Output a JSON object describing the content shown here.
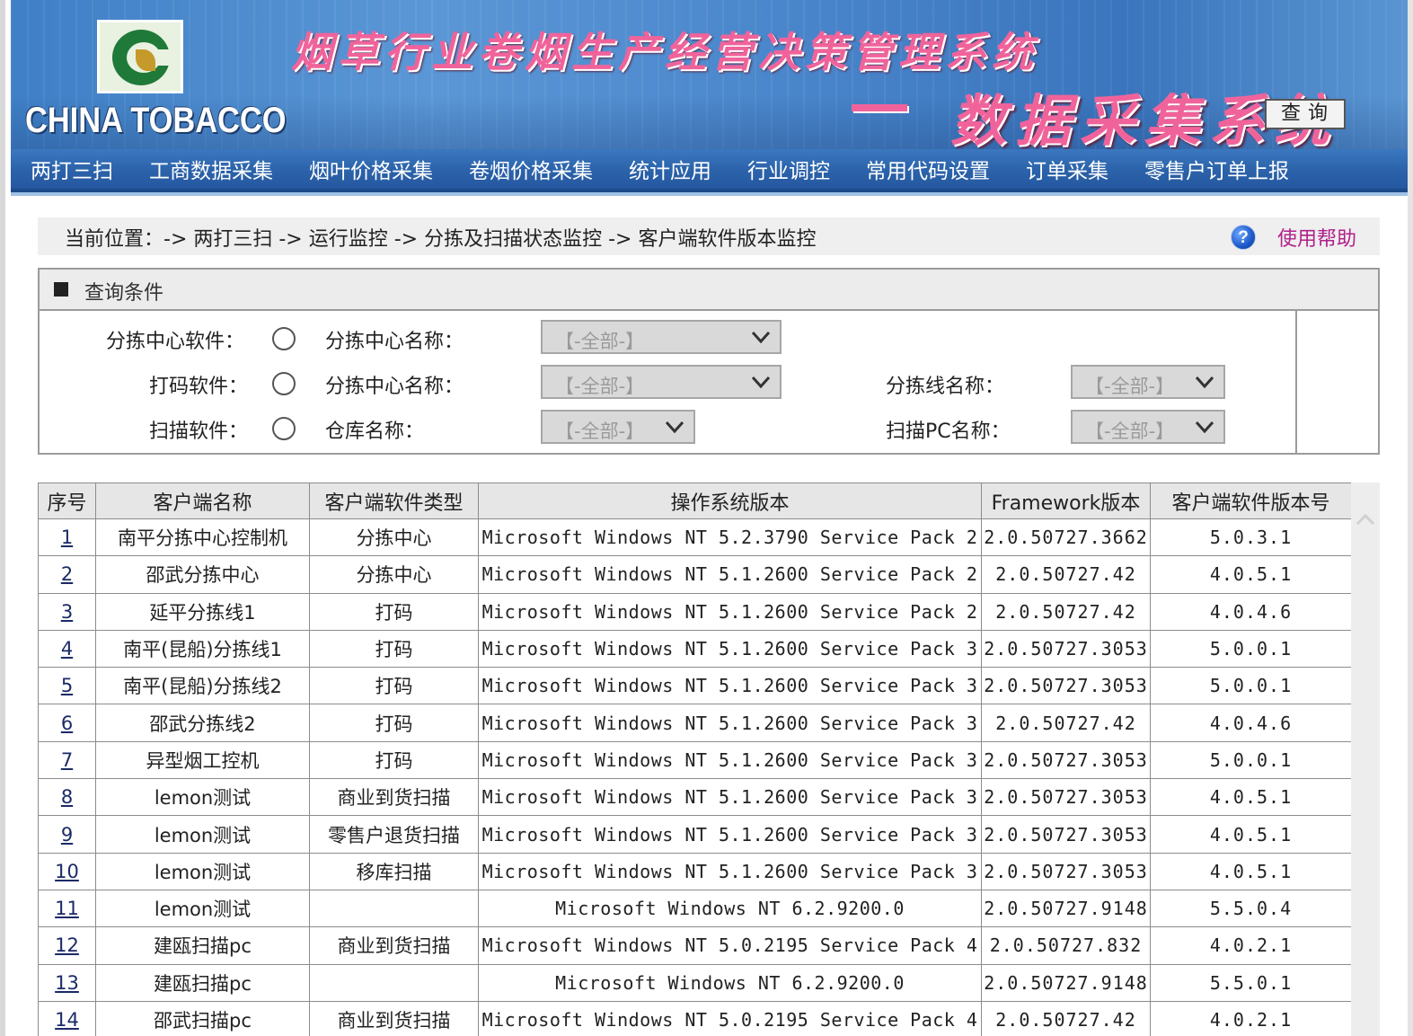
{
  "banner": {
    "brand": "CHINA TOBACCO",
    "title_main": "烟草行业卷烟生产经营决策管理系统",
    "title_sub": "数据采集系统"
  },
  "nav": {
    "items": [
      "两打三扫",
      "工商数据采集",
      "烟叶价格采集",
      "卷烟价格采集",
      "统计应用",
      "行业调控",
      "常用代码设置",
      "订单采集",
      "零售户订单上报"
    ]
  },
  "breadcrumb": {
    "path": "当前位置：-> 两打三扫 -> 运行监控 -> 分拣及扫描状态监控 -> 客户端软件版本监控",
    "help_label": "使用帮助"
  },
  "query": {
    "title": "查询条件",
    "rows": [
      {
        "radio_label": "分拣中心软件：",
        "field1_label": "分拣中心名称：",
        "field1_value": "【-全部-】",
        "field2_label": "",
        "field2_value": ""
      },
      {
        "radio_label": "打码软件：",
        "field1_label": "分拣中心名称：",
        "field1_value": "【-全部-】",
        "field2_label": "分拣线名称：",
        "field2_value": "【-全部-】"
      },
      {
        "radio_label": "扫描软件：",
        "field1_label": "仓库名称：",
        "field1_value": "【-全部-】",
        "field2_label": "扫描PC名称：",
        "field2_value": "【-全部-】"
      }
    ],
    "button_label": "查询"
  },
  "table": {
    "headers": [
      "序号",
      "客户端名称",
      "客户端软件类型",
      "操作系统版本",
      "Framework版本",
      "客户端软件版本号"
    ],
    "rows": [
      [
        "1",
        "南平分拣中心控制机",
        "分拣中心",
        "Microsoft Windows NT 5.2.3790 Service Pack 2",
        "2.0.50727.3662",
        "5.0.3.1"
      ],
      [
        "2",
        "邵武分拣中心",
        "分拣中心",
        "Microsoft Windows NT 5.1.2600 Service Pack 2",
        "2.0.50727.42",
        "4.0.5.1"
      ],
      [
        "3",
        "延平分拣线1",
        "打码",
        "Microsoft Windows NT 5.1.2600 Service Pack 2",
        "2.0.50727.42",
        "4.0.4.6"
      ],
      [
        "4",
        "南平(昆船)分拣线1",
        "打码",
        "Microsoft Windows NT 5.1.2600 Service Pack 3",
        "2.0.50727.3053",
        "5.0.0.1"
      ],
      [
        "5",
        "南平(昆船)分拣线2",
        "打码",
        "Microsoft Windows NT 5.1.2600 Service Pack 3",
        "2.0.50727.3053",
        "5.0.0.1"
      ],
      [
        "6",
        "邵武分拣线2",
        "打码",
        "Microsoft Windows NT 5.1.2600 Service Pack 3",
        "2.0.50727.42",
        "4.0.4.6"
      ],
      [
        "7",
        "异型烟工控机",
        "打码",
        "Microsoft Windows NT 5.1.2600 Service Pack 3",
        "2.0.50727.3053",
        "5.0.0.1"
      ],
      [
        "8",
        "lemon测试",
        "商业到货扫描",
        "Microsoft Windows NT 5.1.2600 Service Pack 3",
        "2.0.50727.3053",
        "4.0.5.1"
      ],
      [
        "9",
        "lemon测试",
        "零售户退货扫描",
        "Microsoft Windows NT 5.1.2600 Service Pack 3",
        "2.0.50727.3053",
        "4.0.5.1"
      ],
      [
        "10",
        "lemon测试",
        "移库扫描",
        "Microsoft Windows NT 5.1.2600 Service Pack 3",
        "2.0.50727.3053",
        "4.0.5.1"
      ],
      [
        "11",
        "lemon测试",
        "",
        "Microsoft Windows NT 6.2.9200.0",
        "2.0.50727.9148",
        "5.5.0.4"
      ],
      [
        "12",
        "建瓯扫描pc",
        "商业到货扫描",
        "Microsoft Windows NT 5.0.2195 Service Pack 4",
        "2.0.50727.832",
        "4.0.2.1"
      ],
      [
        "13",
        "建瓯扫描pc",
        "",
        "Microsoft Windows NT 6.2.9200.0",
        "2.0.50727.9148",
        "5.5.0.1"
      ],
      [
        "14",
        "邵武扫描pc",
        "商业到货扫描",
        "Microsoft Windows NT 5.0.2195 Service Pack 4",
        "2.0.50727.42",
        "4.0.2.1"
      ]
    ]
  },
  "colors": {
    "banner_blue": "#3f7fc6",
    "nav_blue": "#2b62a9",
    "title_pink": "#f0639a",
    "help_link": "#b0208a"
  },
  "icons": {
    "help": "help-icon",
    "select": "chevron-down-icon",
    "scroll": "chevron-up-icon"
  }
}
